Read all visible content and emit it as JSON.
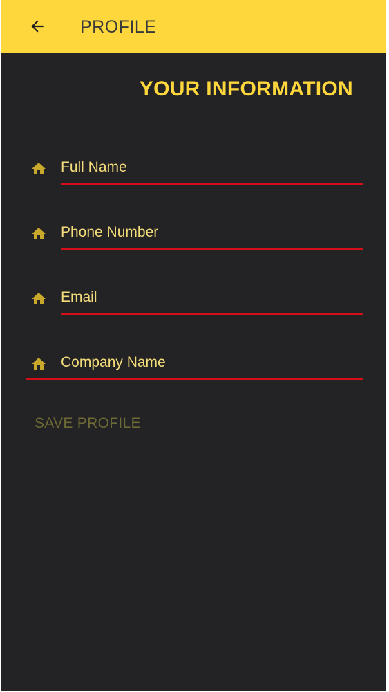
{
  "appbar": {
    "title": "PROFILE",
    "back_icon": "arrow-left-icon"
  },
  "heading": "YOUR INFORMATION",
  "fields": [
    {
      "placeholder": "Full Name",
      "value": "",
      "icon": "home-icon"
    },
    {
      "placeholder": "Phone Number",
      "value": "",
      "icon": "home-icon"
    },
    {
      "placeholder": "Email",
      "value": "",
      "icon": "home-icon"
    },
    {
      "placeholder": "Company Name",
      "value": "",
      "icon": "home-icon"
    }
  ],
  "save_label": "SAVE PROFILE",
  "colors": {
    "accent": "#fdd73c",
    "background": "#232224",
    "underline": "#d50f1a",
    "disabled_text": "#6e6a35"
  }
}
